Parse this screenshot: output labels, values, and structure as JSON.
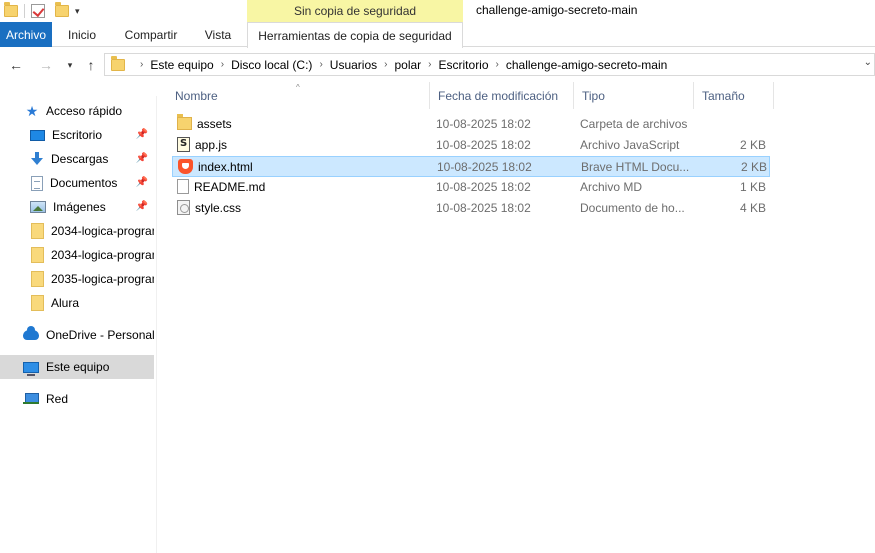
{
  "window": {
    "title": "challenge-amigo-secreto-main",
    "context_tab_header": "Sin copia de seguridad"
  },
  "ribbon": {
    "tabs": [
      {
        "label": "Archivo",
        "active": true
      },
      {
        "label": "Inicio"
      },
      {
        "label": "Compartir"
      },
      {
        "label": "Vista"
      },
      {
        "label": "Herramientas de copia de seguridad"
      }
    ]
  },
  "address_bar": {
    "breadcrumbs": [
      "Este equipo",
      "Disco local (C:)",
      "Usuarios",
      "polar",
      "Escritorio",
      "challenge-amigo-secreto-main"
    ]
  },
  "navigation": {
    "items": [
      {
        "label": "Acceso rápido",
        "icon": "star-icon"
      },
      {
        "label": "Escritorio",
        "icon": "desktop-icon",
        "pinned": true
      },
      {
        "label": "Descargas",
        "icon": "downloads-icon",
        "pinned": true
      },
      {
        "label": "Documentos",
        "icon": "documents-icon",
        "pinned": true
      },
      {
        "label": "Imágenes",
        "icon": "pictures-icon",
        "pinned": true
      },
      {
        "label": "2034-logica-progran",
        "icon": "folder-icon"
      },
      {
        "label": "2034-logica-progran",
        "icon": "folder-icon"
      },
      {
        "label": "2035-logica-progran",
        "icon": "folder-icon"
      },
      {
        "label": "Alura",
        "icon": "folder-icon"
      },
      {
        "label": "OneDrive - Personal",
        "icon": "onedrive-icon"
      },
      {
        "label": "Este equipo",
        "icon": "this-pc-icon",
        "selected": true
      },
      {
        "label": "Red",
        "icon": "network-icon"
      }
    ]
  },
  "file_list": {
    "columns": {
      "name": "Nombre",
      "date": "Fecha de modificación",
      "type": "Tipo",
      "size": "Tamaño"
    },
    "rows": [
      {
        "name": "assets",
        "date": "10-08-2025 18:02",
        "type": "Carpeta de archivos",
        "size": "",
        "icon": "folder-icon"
      },
      {
        "name": "app.js",
        "date": "10-08-2025 18:02",
        "type": "Archivo JavaScript",
        "size": "2 KB",
        "icon": "javascript-file-icon"
      },
      {
        "name": "index.html",
        "date": "10-08-2025 18:02",
        "type": "Brave HTML Docu...",
        "size": "2 KB",
        "icon": "brave-html-icon",
        "selected": true
      },
      {
        "name": "README.md",
        "date": "10-08-2025 18:02",
        "type": "Archivo MD",
        "size": "1 KB",
        "icon": "text-file-icon"
      },
      {
        "name": "style.css",
        "date": "10-08-2025 18:02",
        "type": "Documento de ho...",
        "size": "4 KB",
        "icon": "css-file-icon"
      }
    ]
  },
  "colors": {
    "file_tab_bg": "#1a6fc1",
    "context_tab_bg": "#f8f6a4",
    "selection_bg": "#cce8ff",
    "selection_border": "#99d1ff",
    "column_header_text": "#4d6082"
  }
}
